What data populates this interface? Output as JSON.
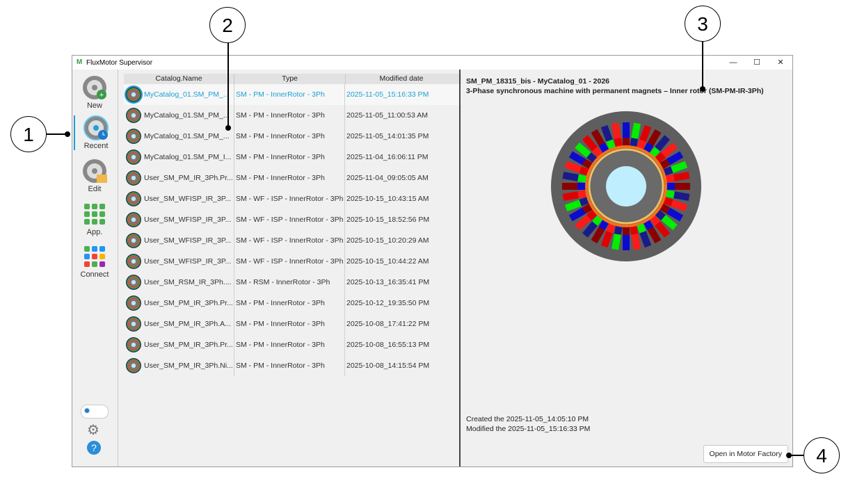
{
  "window": {
    "title": "FluxMotor Supervisor",
    "minimize": "—",
    "maximize": "☐",
    "close": "✕"
  },
  "sidebar": {
    "items": [
      {
        "label": "New"
      },
      {
        "label": "Recent"
      },
      {
        "label": "Edit"
      },
      {
        "label": "App."
      },
      {
        "label": "Connect"
      }
    ]
  },
  "table": {
    "headers": [
      "Catalog.Name",
      "Type",
      "Modified date"
    ],
    "rows": [
      [
        "MyCatalog_01.SM_PM_...",
        "SM - PM - InnerRotor - 3Ph",
        "2025-11-05_15:16:33 PM"
      ],
      [
        "MyCatalog_01.SM_PM_...",
        "SM - PM - InnerRotor - 3Ph",
        "2025-11-05_11:00:53 AM"
      ],
      [
        "MyCatalog_01.SM_PM_...",
        "SM - PM - InnerRotor - 3Ph",
        "2025-11-05_14:01:35 PM"
      ],
      [
        "MyCatalog_01.SM_PM_I...",
        "SM - PM - InnerRotor - 3Ph",
        "2025-11-04_16:06:11 PM"
      ],
      [
        "User_SM_PM_IR_3Ph.Pr...",
        "SM - PM - InnerRotor - 3Ph",
        "2025-11-04_09:05:05 AM"
      ],
      [
        "User_SM_WFISP_IR_3P...",
        "SM - WF - ISP - InnerRotor - 3Ph",
        "2025-10-15_10:43:15 AM"
      ],
      [
        "User_SM_WFISP_IR_3P...",
        "SM - WF - ISP - InnerRotor - 3Ph",
        "2025-10-15_18:52:56 PM"
      ],
      [
        "User_SM_WFISP_IR_3P...",
        "SM - WF - ISP - InnerRotor - 3Ph",
        "2025-10-15_10:20:29 AM"
      ],
      [
        "User_SM_WFISP_IR_3P...",
        "SM - WF - ISP - InnerRotor - 3Ph",
        "2025-10-15_10:44:22 AM"
      ],
      [
        "User_SM_RSM_IR_3Ph....",
        "SM - RSM - InnerRotor - 3Ph",
        "2025-10-13_16:35:41 PM"
      ],
      [
        "User_SM_PM_IR_3Ph.Pr...",
        "SM - PM - InnerRotor - 3Ph",
        "2025-10-12_19:35:50 PM"
      ],
      [
        "User_SM_PM_IR_3Ph.A...",
        "SM - PM - InnerRotor - 3Ph",
        "2025-10-08_17:41:22 PM"
      ],
      [
        "User_SM_PM_IR_3Ph.Pr...",
        "SM - PM - InnerRotor - 3Ph",
        "2025-10-08_16:55:13 PM"
      ],
      [
        "User_SM_PM_IR_3Ph.Ni...",
        "SM - PM - InnerRotor - 3Ph",
        "2025-10-08_14:15:54 PM"
      ]
    ]
  },
  "detail": {
    "title": "SM_PM_18315_bis - MyCatalog_01 - 2026",
    "subtitle": "3-Phase synchronous machine with permanent magnets – Inner rotor (SM-PM-IR-3Ph)",
    "created": "Created the 2025-11-05_14:05:10 PM",
    "modified": "Modified the 2025-11-05_15:16:33 PM",
    "open_button": "Open in Motor Factory"
  },
  "callouts": [
    "1",
    "2",
    "3",
    "4"
  ],
  "colors": {
    "accent": "#1ea0d0"
  }
}
